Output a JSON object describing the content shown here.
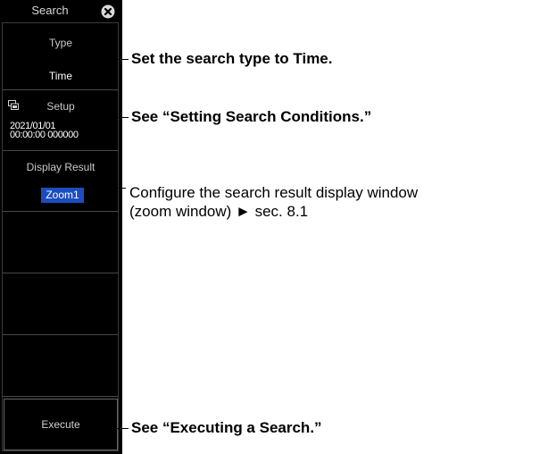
{
  "menu": {
    "title": "Search",
    "type": {
      "label": "Type",
      "value": "Time"
    },
    "setup": {
      "label": "Setup",
      "date": "2021/01/01",
      "time": "00:00:00 000000"
    },
    "display_result": {
      "label": "Display Result",
      "value": "Zoom1"
    },
    "execute_label": "Execute"
  },
  "annotations": {
    "type_note": "Set the search type to Time.",
    "setup_note": "See “Setting Search Conditions.”",
    "display_note_line1": "Configure the search result display window",
    "display_note_line2": "(zoom window) ► sec. 8.1",
    "execute_note": "See “Executing a Search.”"
  },
  "colors": {
    "panel_bg": "#000000",
    "selection_highlight": "#1c4cbf"
  },
  "icons": {
    "close": "close-icon",
    "setup": "setup-icon"
  }
}
